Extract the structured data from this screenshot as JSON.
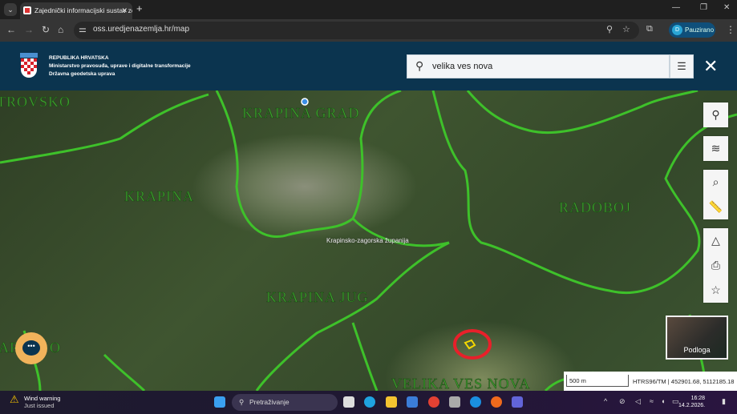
{
  "browser": {
    "tab_title": "Zajednički informacijski sustav ze",
    "url": "oss.uredjenazemlja.hr/map",
    "profile_initial": "D",
    "profile_label": "Pauzirano"
  },
  "header": {
    "org_line1": "REPUBLIKA HRVATSKA",
    "org_line2": "Ministarstvo pravosuđa, uprave i digitalne transformacije",
    "org_line3": "Državna geodetska uprava",
    "search_value": "velika ves nova"
  },
  "map": {
    "labels": [
      "TROVSKO",
      "KRAPINA GRAD",
      "KRAPINA",
      "RADOBOJ",
      "KRAPINA JUG",
      "AR",
      "O",
      "VELIKA VES NOVA"
    ],
    "county_label": "Krapinsko-zagorska županija",
    "basemap_label": "Podloga",
    "scale": "500 m",
    "coords": "HTRS96/TM | 452901.68, 5112185.18",
    "boundary_color": "#3ec12a",
    "marker_color": "#e8202a",
    "parcel_color": "#f5d800"
  },
  "tools": [
    "location-pin",
    "layers",
    "search-location",
    "ruler",
    "shapes",
    "print",
    "favorite"
  ],
  "taskbar": {
    "weather_title": "Wind warning",
    "weather_sub": "Just issued",
    "search_placeholder": "Pretraživanje",
    "time": "16:28",
    "date": "14.2.2026."
  }
}
